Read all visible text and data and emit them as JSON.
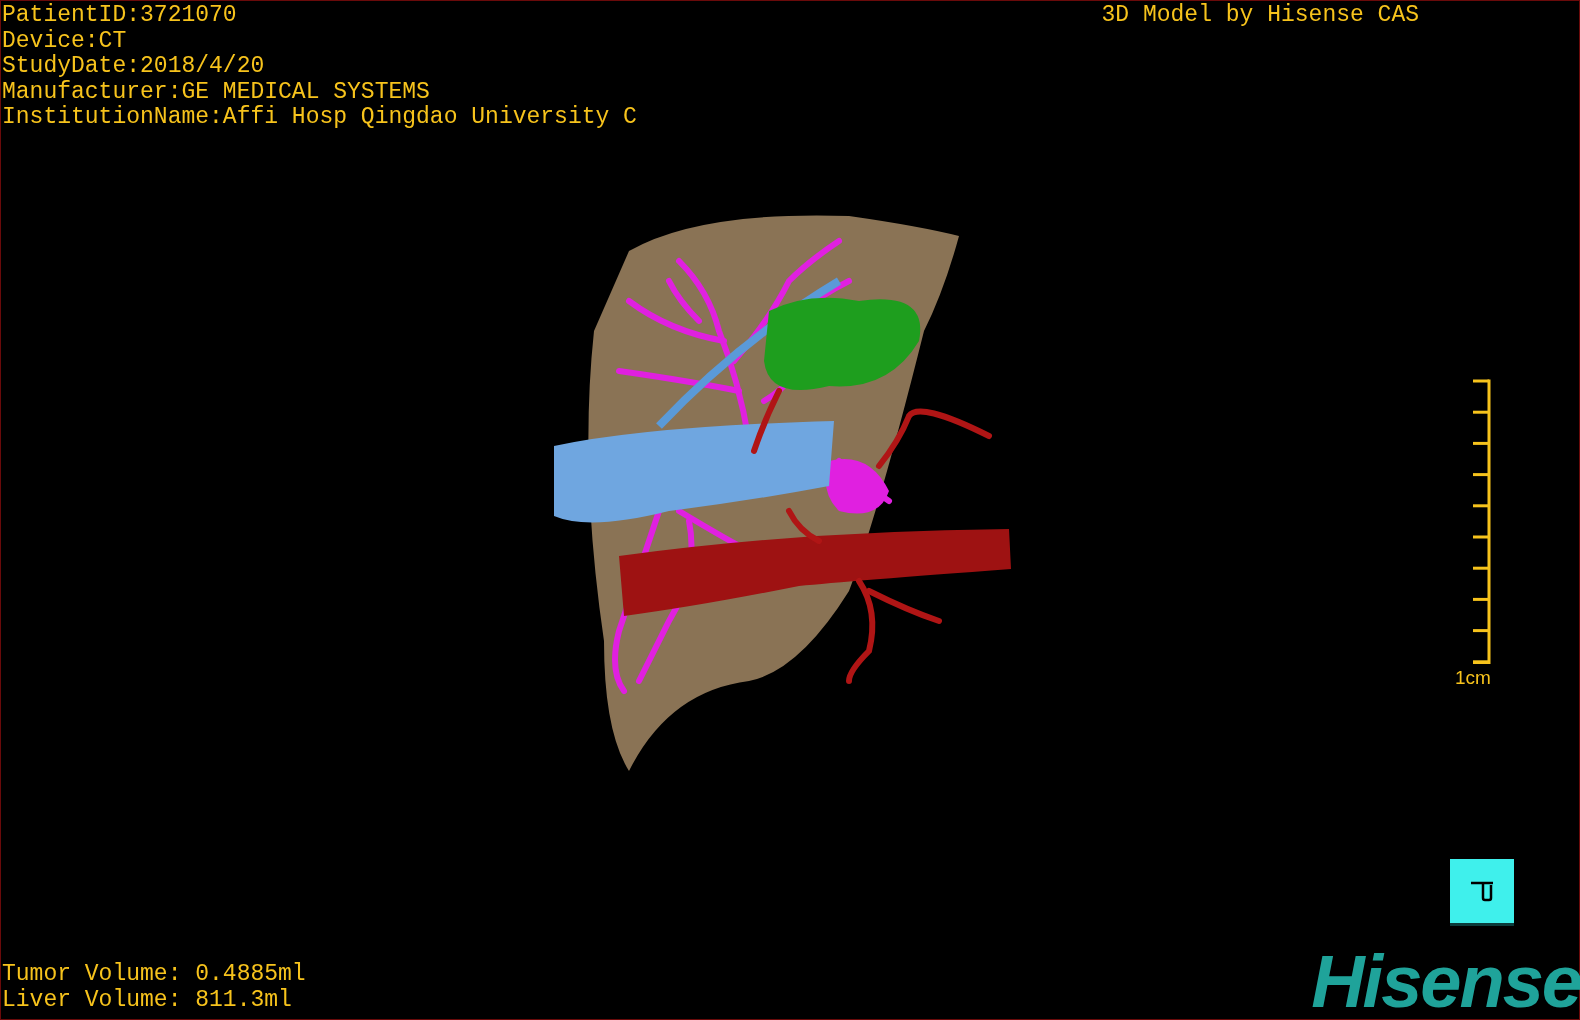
{
  "overlay": {
    "info_lines": [
      "PatientID:3721070",
      "Device:CT",
      "StudyDate:2018/4/20",
      "Manufacturer:GE MEDICAL SYSTEMS",
      "InstitutionName:Affi Hosp Qingdao University C"
    ],
    "title": "3D Model by Hisense CAS"
  },
  "scale_bar": {
    "label": "1cm"
  },
  "volumes": [
    "Tumor Volume: 0.4885ml",
    "Liver Volume: 811.3ml"
  ],
  "logo": "Hisense"
}
